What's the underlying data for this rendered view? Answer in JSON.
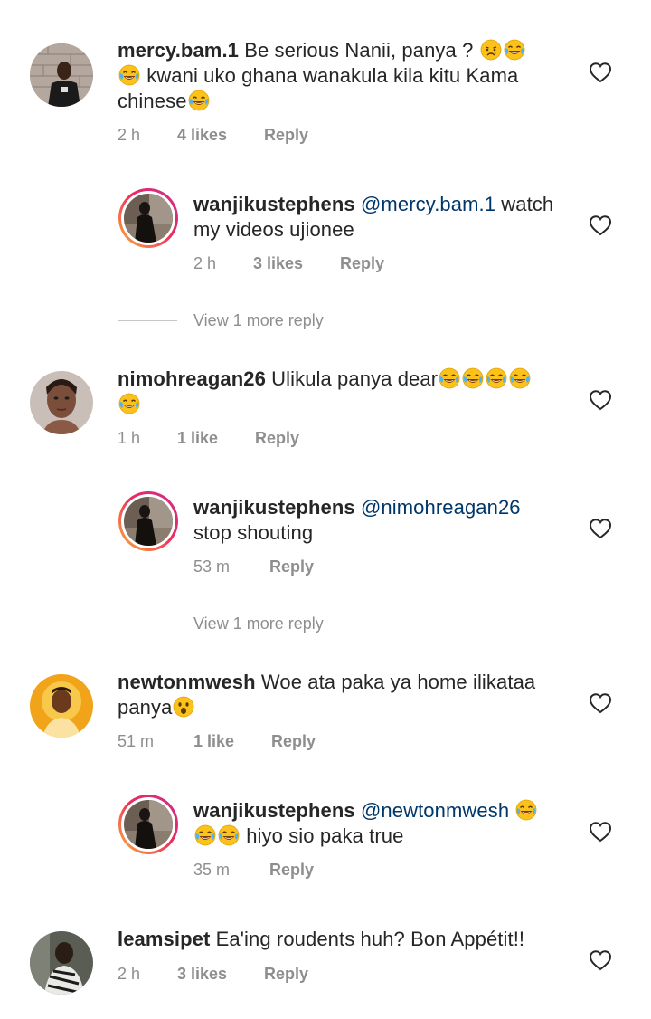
{
  "comments": [
    {
      "username": "mercy.bam.1",
      "text_line1": "Be serious Nanii, panya ?",
      "text_line2": "kwani uko ghana wanakula kila kitu Kama",
      "text_line3": "chinese",
      "time": "2 h",
      "likes": "4 likes",
      "reply": "Reply"
    },
    {
      "username": "wanjikustephens",
      "mention": "@mercy.bam.1",
      "text_tail": "watch",
      "text_line2": "my videos ujionee",
      "time": "2 h",
      "likes": "3 likes",
      "reply": "Reply",
      "view_more": "View 1 more reply"
    },
    {
      "username": "nimohreagan26",
      "text_line1": "Ulikula panya dear",
      "time": "1 h",
      "likes": "1 like",
      "reply": "Reply"
    },
    {
      "username": "wanjikustephens",
      "mention": "@nimohreagan26",
      "text_line2": "stop shouting",
      "time": "53 m",
      "reply": "Reply",
      "view_more": "View 1 more reply"
    },
    {
      "username": "newtonmwesh",
      "text_line1": "Woe ata paka ya home ilikataa",
      "text_line2": "panya",
      "time": "51 m",
      "likes": "1 like",
      "reply": "Reply"
    },
    {
      "username": "wanjikustephens",
      "mention": "@newtonmwesh",
      "text_line2": "hiyo sio paka true",
      "time": "35 m",
      "reply": "Reply"
    },
    {
      "username": "leamsipet",
      "text_line1": "Ea'ing roudents huh? Bon Appétit!!",
      "time": "2 h",
      "likes": "3 likes",
      "reply": "Reply"
    }
  ],
  "icons": {
    "like": "heart-outline-icon",
    "laugh": "face-with-tears-of-joy-emoji",
    "sad": "crying-face-emoji",
    "surprised": "astonished-face-emoji"
  },
  "colors": {
    "text": "#262626",
    "meta": "#8e8e8e",
    "mention": "#00376b"
  }
}
